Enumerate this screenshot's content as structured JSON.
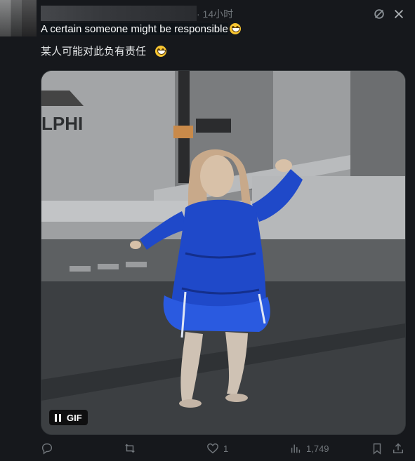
{
  "tweet": {
    "time": "· 14小时",
    "text_line1": "A certain someone might be responsible",
    "text_line2": "某人可能对此负有责任",
    "media": {
      "badge_label": "GIF",
      "sign_text": "LPHI"
    }
  },
  "actions": {
    "reply_count": "",
    "retweet_count": "",
    "like_count": "1",
    "views_count": "1,749"
  },
  "colors": {
    "background": "#16181c",
    "text": "#e7e9ea",
    "muted": "#71767b",
    "coat": "#1f49c9"
  }
}
